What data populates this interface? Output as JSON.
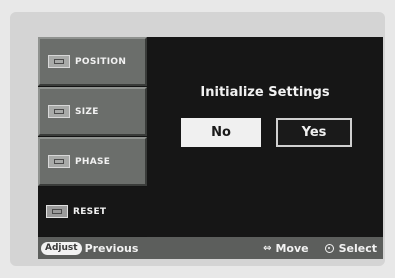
{
  "sidebar": {
    "items": [
      {
        "label": "POSITION",
        "icon": "position-icon"
      },
      {
        "label": "SIZE",
        "icon": "size-icon"
      },
      {
        "label": "PHASE",
        "icon": "phase-icon"
      },
      {
        "label": "RESET",
        "icon": "reset-icon"
      }
    ]
  },
  "dialog": {
    "title": "Initialize Settings",
    "no_label": "No",
    "yes_label": "Yes"
  },
  "footer": {
    "adjust_label": "Adjust",
    "previous_label": "Previous",
    "move_label": "Move",
    "select_label": "Select"
  },
  "colors": {
    "screen_bg": "#161616",
    "menu_grey": "#6b6e6b",
    "footer_bg": "#5c5e5c",
    "text": "#f2f2f2"
  }
}
